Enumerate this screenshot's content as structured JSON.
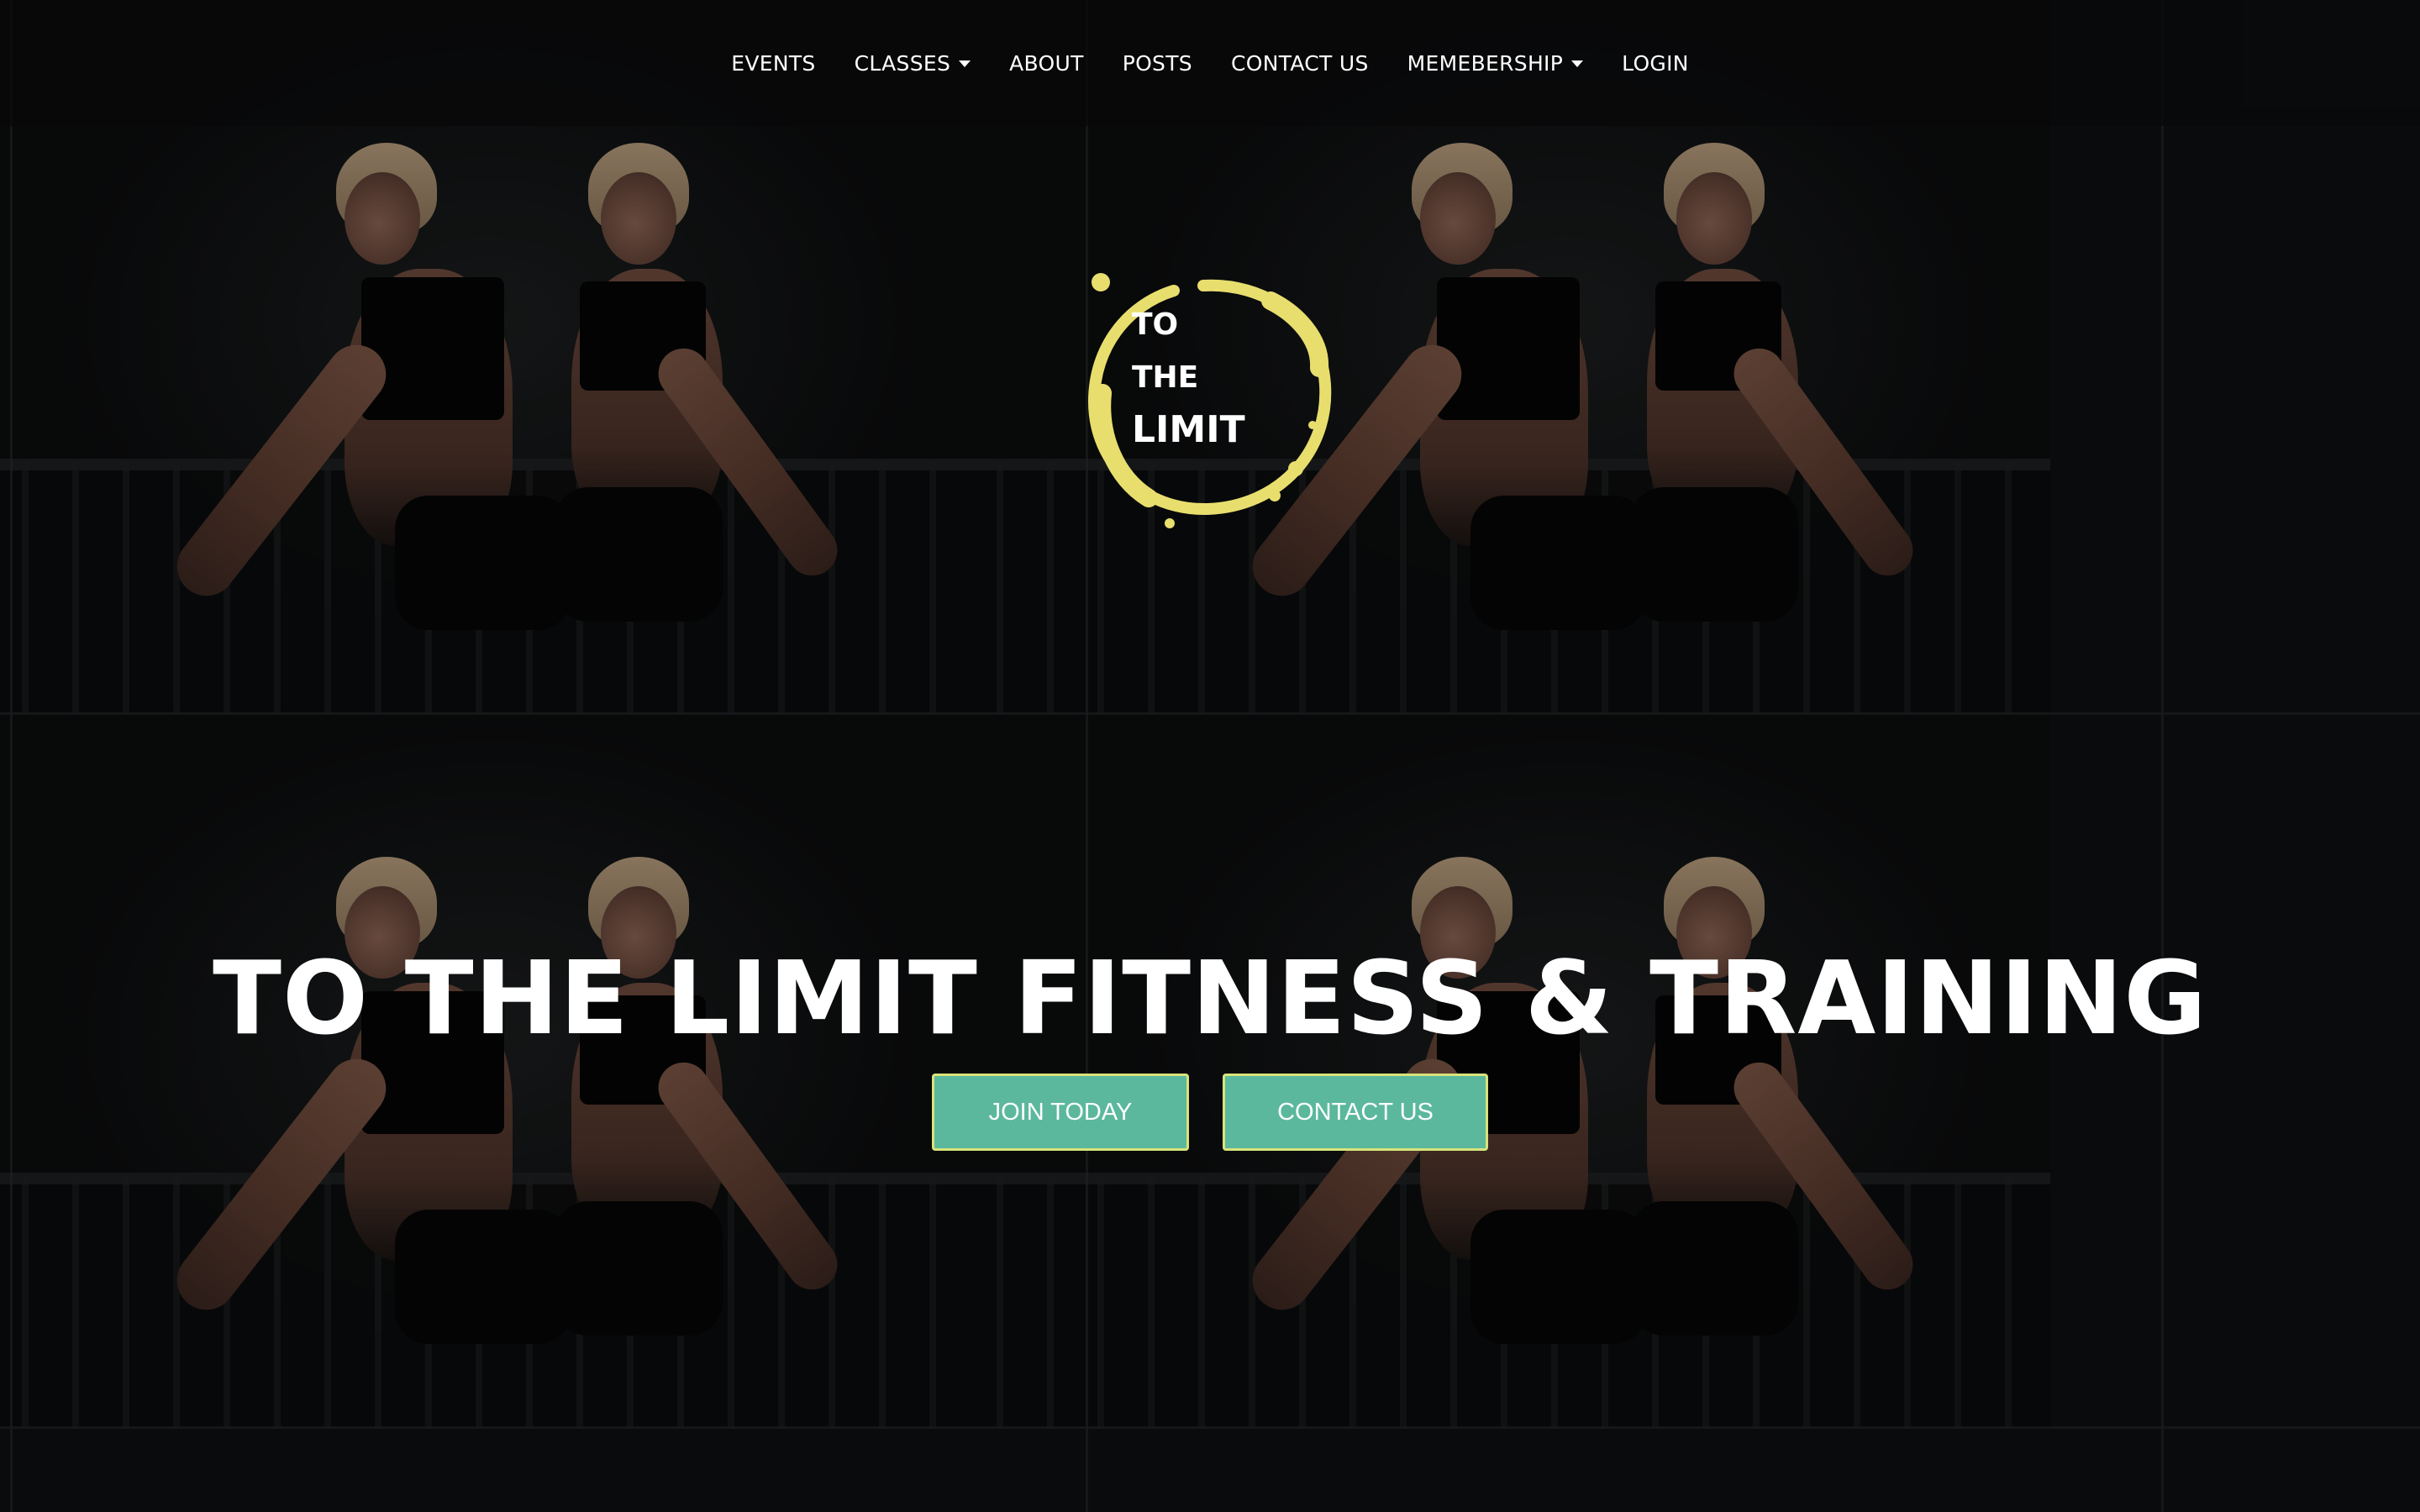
{
  "nav": {
    "items": [
      {
        "label": "EVENTS",
        "has_dropdown": false
      },
      {
        "label": "CLASSES",
        "has_dropdown": true
      },
      {
        "label": "ABOUT",
        "has_dropdown": false
      },
      {
        "label": "POSTS",
        "has_dropdown": false
      },
      {
        "label": "CONTACT US",
        "has_dropdown": false
      },
      {
        "label": "MEMEBERSHIP",
        "has_dropdown": true
      },
      {
        "label": "LOGIN",
        "has_dropdown": false
      }
    ]
  },
  "logo": {
    "line1": "TO",
    "line2": "THE",
    "line3": "LIMIT",
    "ring_color": "#e8de6e"
  },
  "hero": {
    "title": "TO THE LIMIT FITNESS & TRAINING",
    "join_label": "JOIN TODAY",
    "contact_label": "CONTACT US"
  },
  "colors": {
    "button_bg": "#5bb89c",
    "button_border": "#d8e37a",
    "nav_bg": "#08090a",
    "page_bg": "#0d0f10"
  }
}
